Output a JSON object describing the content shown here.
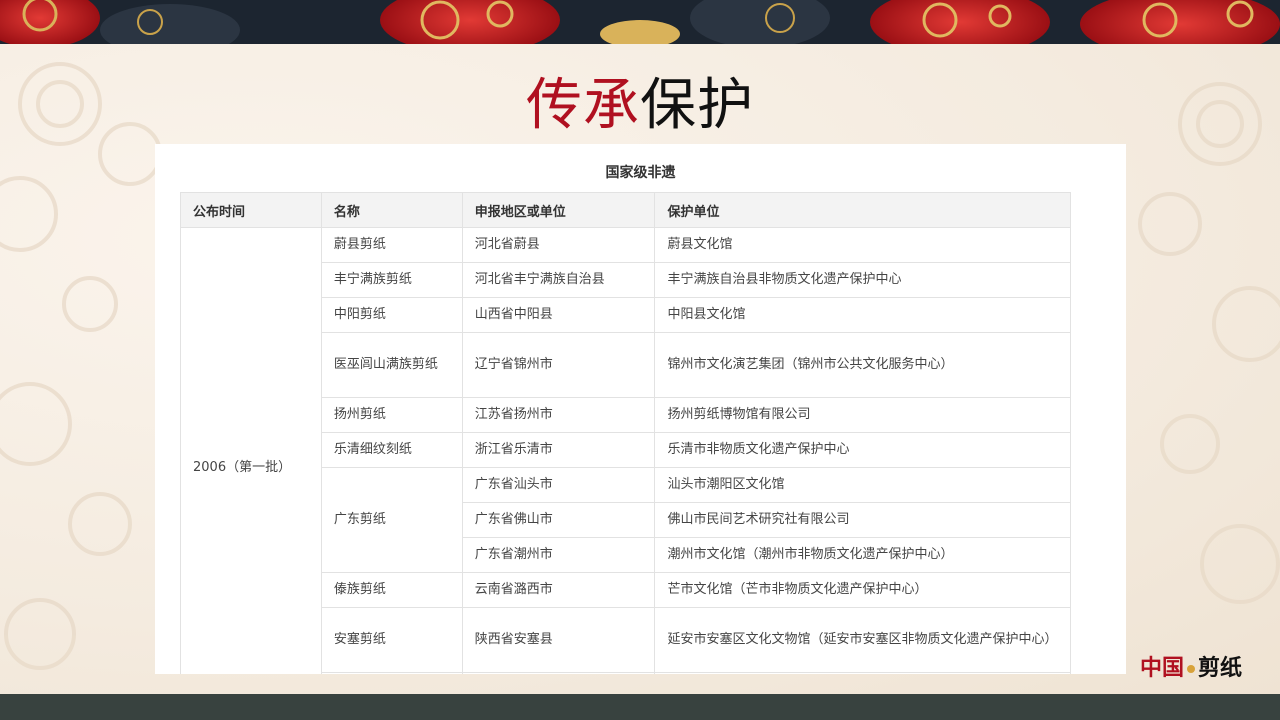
{
  "slide": {
    "title_red": "传承",
    "title_black": "保护",
    "brand_left": "中国",
    "brand_right": "剪纸"
  },
  "table": {
    "caption": "国家级非遗",
    "headers": [
      "公布时间",
      "名称",
      "申报地区或单位",
      "保护单位"
    ],
    "batch": "2006（第一批）",
    "rows": [
      {
        "name": "蔚县剪纸",
        "region": "河北省蔚县",
        "unit": "蔚县文化馆"
      },
      {
        "name": "丰宁满族剪纸",
        "region": "河北省丰宁满族自治县",
        "unit": "丰宁满族自治县非物质文化遗产保护中心"
      },
      {
        "name": "中阳剪纸",
        "region": "山西省中阳县",
        "unit": "中阳县文化馆"
      },
      {
        "name": "医巫闾山满族剪纸",
        "region": "辽宁省锦州市",
        "unit": "锦州市文化演艺集团（锦州市公共文化服务中心）"
      },
      {
        "name": "扬州剪纸",
        "region": "江苏省扬州市",
        "unit": "扬州剪纸博物馆有限公司"
      },
      {
        "name": "乐清细纹刻纸",
        "region": "浙江省乐清市",
        "unit": "乐清市非物质文化遗产保护中心"
      },
      {
        "name": "广东剪纸",
        "region": "广东省汕头市",
        "unit": "汕头市潮阳区文化馆"
      },
      {
        "name": "",
        "region": "广东省佛山市",
        "unit": "佛山市民间艺术研究社有限公司"
      },
      {
        "name": "",
        "region": "广东省潮州市",
        "unit": "潮州市文化馆（潮州市非物质文化遗产保护中心）"
      },
      {
        "name": "傣族剪纸",
        "region": "云南省潞西市",
        "unit": "芒市文化馆（芒市非物质文化遗产保护中心）"
      },
      {
        "name": "安塞剪纸",
        "region": "陕西省安塞县",
        "unit": "延安市安塞区文化文物馆（延安市安塞区非物质文化遗产保护中心）"
      }
    ]
  }
}
